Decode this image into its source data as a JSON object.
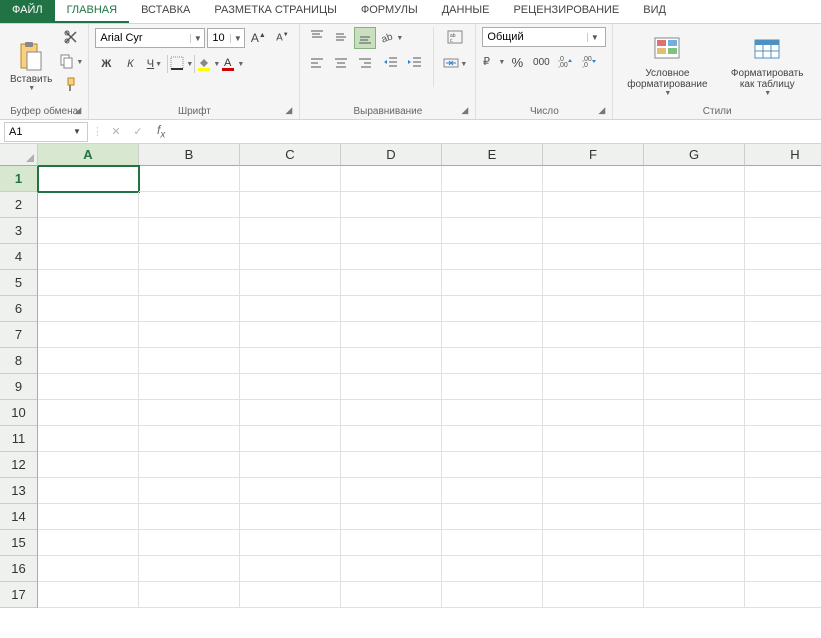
{
  "tabs": {
    "file": "ФАЙЛ",
    "home": "ГЛАВНАЯ",
    "insert": "ВСТАВКА",
    "pagelayout": "РАЗМЕТКА СТРАНИЦЫ",
    "formulas": "ФОРМУЛЫ",
    "data": "ДАННЫЕ",
    "review": "РЕЦЕНЗИРОВАНИЕ",
    "view": "ВИД"
  },
  "ribbon": {
    "clipboard": {
      "label": "Буфер обмена",
      "paste": "Вставить"
    },
    "font": {
      "label": "Шрифт",
      "name": "Arial Cyr",
      "size": "10",
      "bold": "Ж",
      "italic": "К",
      "underline": "Ч"
    },
    "alignment": {
      "label": "Выравнивание"
    },
    "number": {
      "label": "Число",
      "format": "Общий"
    },
    "styles": {
      "label": "Стили",
      "conditional": "Условное форматирование",
      "astable": "Форматировать как таблицу"
    }
  },
  "formula_bar": {
    "cell_ref": "A1",
    "formula": ""
  },
  "grid": {
    "columns": [
      "A",
      "B",
      "C",
      "D",
      "E",
      "F",
      "G",
      "H"
    ],
    "rows": [
      "1",
      "2",
      "3",
      "4",
      "5",
      "6",
      "7",
      "8",
      "9",
      "10",
      "11",
      "12",
      "13",
      "14",
      "15",
      "16",
      "17"
    ],
    "selected_cell": "A1"
  }
}
